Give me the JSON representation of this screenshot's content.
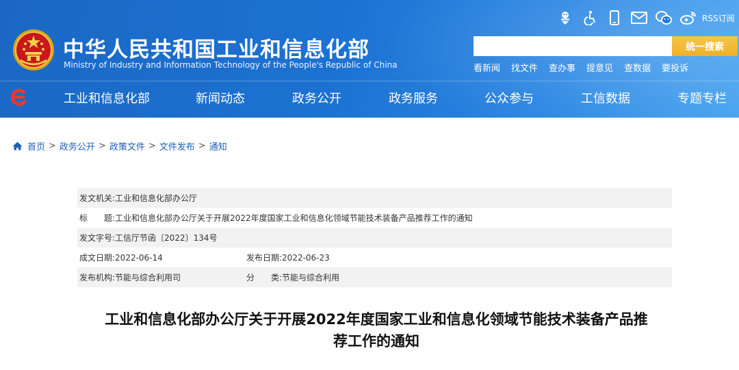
{
  "header": {
    "title": "中华人民共和国工业和信息化部",
    "subtitle": "Ministry of Industry and Information Technology of the People's Republic of China",
    "tools": [
      {
        "icon": "voice-assist-icon"
      },
      {
        "icon": "accessibility-icon"
      },
      {
        "icon": "mobile-icon"
      },
      {
        "icon": "mail-icon"
      },
      {
        "icon": "wechat-icon"
      },
      {
        "icon": "weibo-icon"
      }
    ],
    "rss_label": "RSS订阅",
    "search": {
      "placeholder": "",
      "button_label": "统一搜索"
    },
    "quick_links": [
      "看新闻",
      "找文件",
      "查办事",
      "提意见",
      "查数据",
      "要投诉"
    ]
  },
  "nav": {
    "items": [
      "工业和信息化部",
      "新闻动态",
      "政务公开",
      "政务服务",
      "公众参与",
      "工信数据",
      "专题专栏"
    ]
  },
  "breadcrumb": {
    "items": [
      "首页",
      "政务公开",
      "政策文件",
      "文件发布",
      "通知"
    ],
    "separator": ">"
  },
  "meta": {
    "issuer_label": "发文机关:",
    "issuer": "工业和信息化部办公厅",
    "title_label": "标　　题:",
    "title": "工业和信息化部办公厅关于开展2022年度国家工业和信息化领域节能技术装备产品推荐工作的通知",
    "doc_no_label": "发文字号:",
    "doc_no": "工信厅节函〔2022〕134号",
    "date_created_label": "成文日期:",
    "date_created": "2022-06-14",
    "date_published_label": "发布日期:",
    "date_published": "2022-06-23",
    "org_label": "发布机构:",
    "org": "节能与综合利用司",
    "category_label": "分　　类:",
    "category": "节能与综合利用"
  },
  "doc": {
    "title_line1": "工业和信息化部办公厅关于开展2022年度国家工业和信息化领域节能技术装备产品推",
    "title_line2": "荐工作的通知"
  },
  "colors": {
    "header_blue": "#1c72d2",
    "search_button": "#eeb126",
    "link_blue": "#1c5fb8",
    "meta_shade": "#f2f2f2"
  }
}
